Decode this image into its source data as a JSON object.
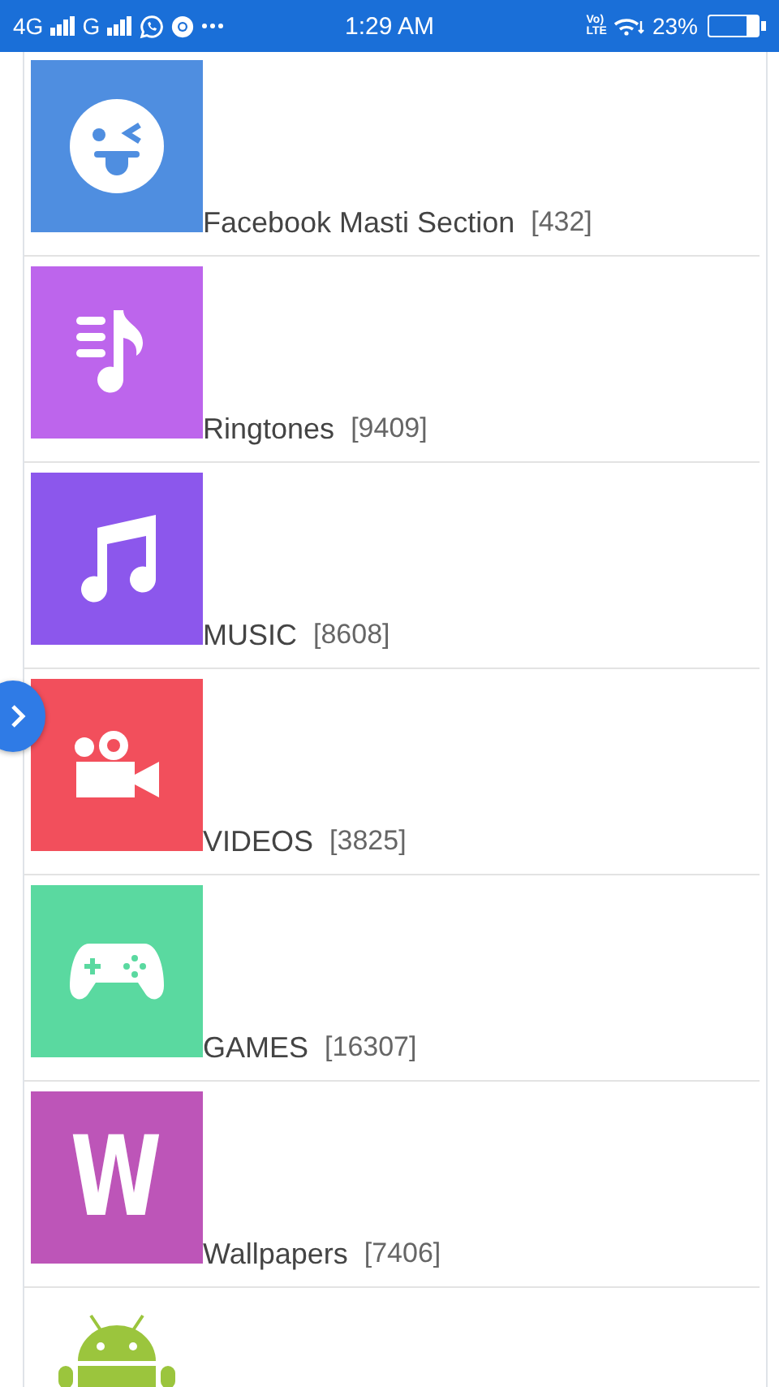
{
  "status_bar": {
    "network_1": "4G",
    "network_2": "G",
    "time": "1:29 AM",
    "volte": [
      "Vo)",
      "LTE"
    ],
    "battery_text": "23%",
    "battery": {
      "level": 0.23
    }
  },
  "categories": [
    {
      "title": "Facebook Masti Section",
      "count": "[432]",
      "kind": "emoji",
      "color": "#4f8ee0"
    },
    {
      "title": "Ringtones",
      "count": "[9409]",
      "kind": "playlist",
      "color": "#bd65ec"
    },
    {
      "title": "MUSIC",
      "count": "[8608]",
      "kind": "note",
      "color": "#8c57ec"
    },
    {
      "title": "VIDEOS",
      "count": "[3825]",
      "kind": "camera",
      "color": "#f24f5c"
    },
    {
      "title": "GAMES",
      "count": "[16307]",
      "kind": "gamepad",
      "color": "#5ad9a0"
    },
    {
      "title": "Wallpapers",
      "count": "[7406]",
      "kind": "letter",
      "letter": "W",
      "color": "#bd55b8"
    },
    {
      "kind": "android"
    }
  ]
}
